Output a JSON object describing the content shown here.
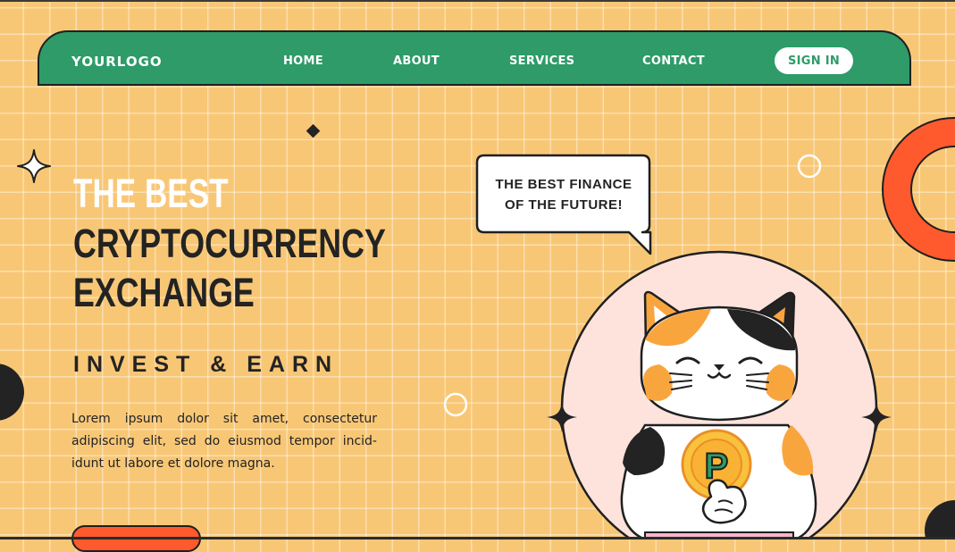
{
  "nav": {
    "logo": "YOURLOGO",
    "links": [
      "HOME",
      "ABOUT",
      "SERVICES",
      "CONTACT"
    ],
    "signin": "SIGN IN"
  },
  "hero": {
    "line1": "THE BEST",
    "line2": "CRYPTOCURRENCY",
    "line3": "EXCHANGE",
    "subtitle": "INVEST & EARN",
    "body_lines": [
      "Lorem ipsum dolor sit amet, consectetur",
      "adipiscing elit, sed do eiusmod tempor incid-",
      "idunt ut labore et dolore magna."
    ]
  },
  "speech_bubble": {
    "line1": "THE BEST FINANCE",
    "line2": "OF THE FUTURE!"
  },
  "coin": {
    "symbol": "P"
  },
  "colors": {
    "background": "#f8c776",
    "nav_green": "#2e9b68",
    "accent_orange": "#ff5a2e",
    "dark": "#232323",
    "circle_pink": "#fde3dc",
    "coin_gold": "#f9c23c"
  }
}
